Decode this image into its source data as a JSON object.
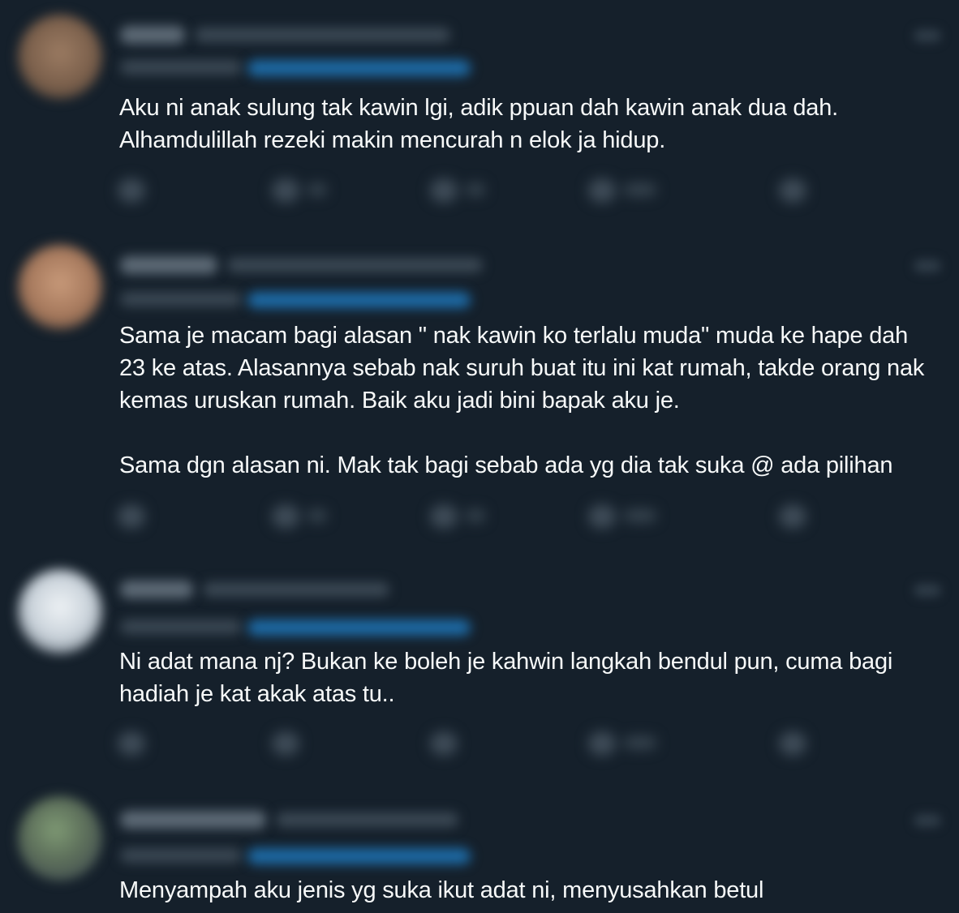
{
  "feed": {
    "tweets": [
      {
        "text": "Aku ni anak sulung tak kawin lgi, adik ppuan dah kawin anak dua dah.\nAlhamdulillah rezeki makin mencurah n elok ja hidup.",
        "avatar_color": "#8a6d57"
      },
      {
        "text": "Sama je macam bagi alasan \" nak kawin ko terlalu muda\" muda ke hape dah 23 ke atas. Alasannya sebab nak suruh buat itu ini kat rumah, takde orang nak kemas uruskan rumah. Baik aku jadi bini bapak aku je.\n\nSama dgn alasan ni. Mak tak bagi sebab ada yg dia tak suka @ ada pilihan",
        "avatar_color": "#b08064"
      },
      {
        "text": "Ni adat mana nj? Bukan ke boleh je kahwin langkah bendul pun, cuma bagi hadiah je kat akak atas tu..",
        "avatar_color": "#cfd6dd"
      },
      {
        "text": "Menyampah aku jenis yg suka ikut adat ni, menyusahkan betul",
        "avatar_color": "#5a6a58"
      }
    ],
    "icons": [
      "reply-icon",
      "retweet-icon",
      "like-icon",
      "views-icon",
      "share-icon"
    ]
  }
}
